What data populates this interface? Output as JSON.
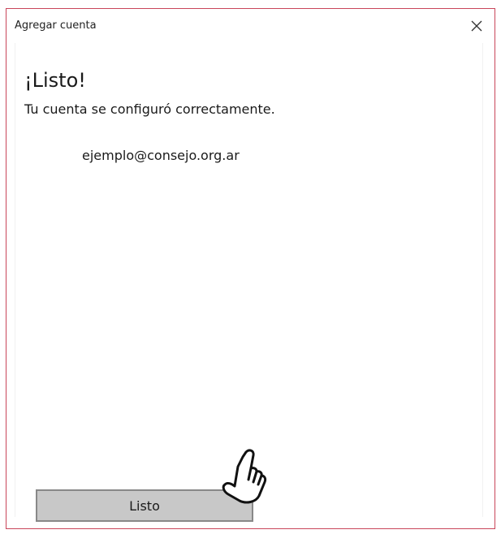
{
  "window": {
    "title": "Agregar cuenta"
  },
  "content": {
    "heading": "¡Listo!",
    "subtitle": "Tu cuenta se configuró correctamente.",
    "account_email": "ejemplo@consejo.org.ar"
  },
  "footer": {
    "done_label": "Listo"
  },
  "icons": {
    "close": "close-icon",
    "cursor": "hand-pointer-icon"
  },
  "colors": {
    "window_border": "#c9455a",
    "button_background": "#c8c8c8",
    "button_border": "#888888"
  }
}
